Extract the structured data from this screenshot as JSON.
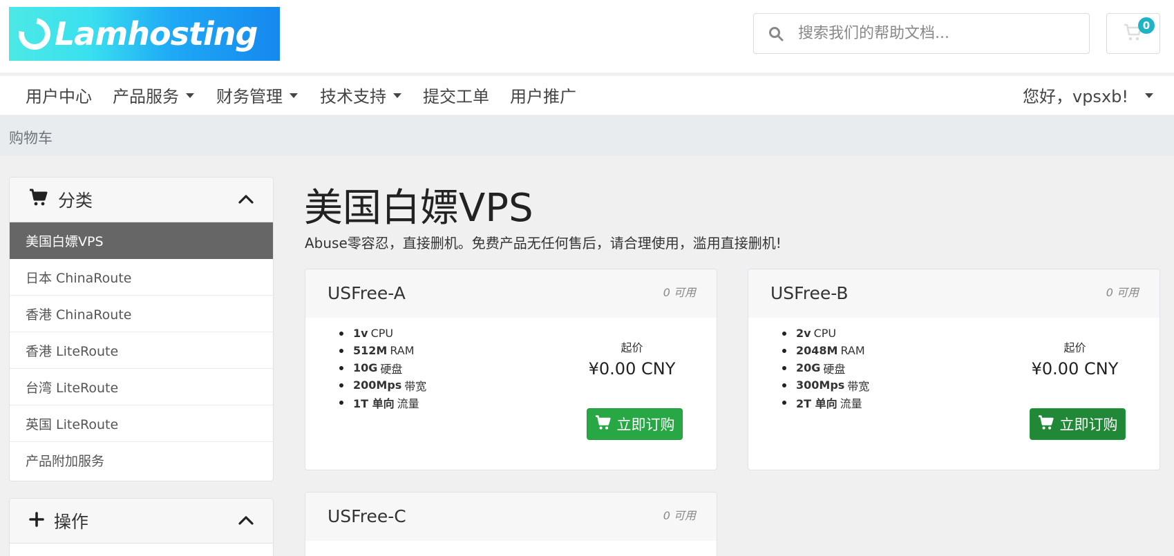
{
  "brand": {
    "logo_text": "Lamhosting"
  },
  "search": {
    "placeholder": "搜索我们的帮助文档..."
  },
  "cart": {
    "count": "0"
  },
  "nav": {
    "items": [
      {
        "label": "用户中心"
      },
      {
        "label": "产品服务"
      },
      {
        "label": "财务管理"
      },
      {
        "label": "技术支持"
      },
      {
        "label": "提交工单"
      },
      {
        "label": "用户推广"
      }
    ],
    "user_greeting": "您好，vpsxb!"
  },
  "breadcrumb": {
    "current": "购物车"
  },
  "sidebar": {
    "categories_title": "分类",
    "categories": [
      {
        "label": "美国白嫖VPS",
        "active": true
      },
      {
        "label": "日本 ChinaRoute"
      },
      {
        "label": "香港 ChinaRoute"
      },
      {
        "label": "香港 LiteRoute"
      },
      {
        "label": "台湾 LiteRoute"
      },
      {
        "label": "英国 LiteRoute"
      },
      {
        "label": "产品附加服务"
      }
    ],
    "actions_title": "操作"
  },
  "main": {
    "title": "美国白嫖VPS",
    "subtitle": "Abuse零容忍，直接删机。免费产品无任何售后，请合理使用，滥用直接删机!"
  },
  "products": [
    {
      "name": "USFree-A",
      "availability": "0 可用",
      "features": [
        {
          "value": "1v",
          "unit": "CPU"
        },
        {
          "value": "512M",
          "unit": "RAM"
        },
        {
          "value": "10G",
          "unit": "硬盘"
        },
        {
          "value": "200Mps",
          "unit": "带宽"
        },
        {
          "value": "1T 单向",
          "unit": "流量"
        }
      ],
      "price_label": "起价",
      "price": "¥0.00 CNY",
      "order_label": "立即订购"
    },
    {
      "name": "USFree-B",
      "availability": "0 可用",
      "features": [
        {
          "value": "2v",
          "unit": "CPU"
        },
        {
          "value": "2048M",
          "unit": "RAM"
        },
        {
          "value": "20G",
          "unit": "硬盘"
        },
        {
          "value": "300Mps",
          "unit": "带宽"
        },
        {
          "value": "2T 单向",
          "unit": "流量"
        }
      ],
      "price_label": "起价",
      "price": "¥0.00 CNY",
      "order_label": "立即订购"
    },
    {
      "name": "USFree-C",
      "availability": "0 可用"
    }
  ],
  "colors": {
    "accent_green": "#28a745",
    "badge": "#1fb3c6",
    "sidebar_active": "#666666"
  },
  "icons": [
    "search-icon",
    "cart-icon",
    "chevron-up-icon",
    "plus-icon",
    "caret-down-icon"
  ]
}
